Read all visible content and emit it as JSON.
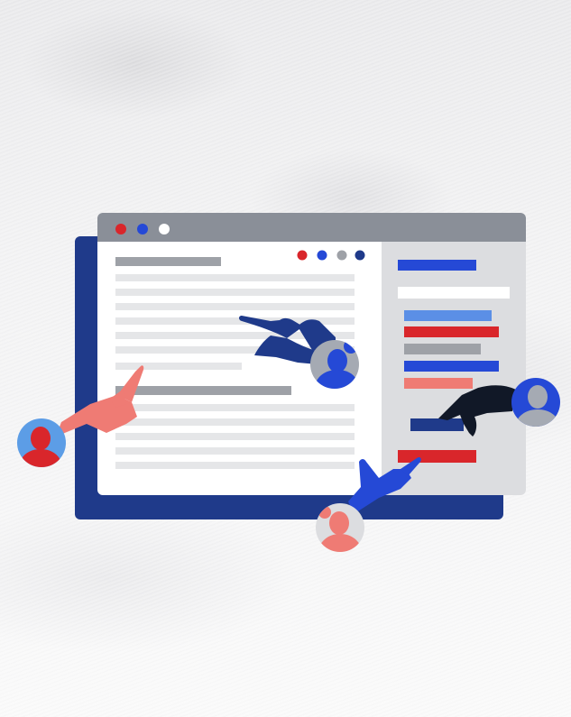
{
  "colors": {
    "navy": "#1f3a8a",
    "blue": "#2549d6",
    "light_blue": "#5b8fe6",
    "red": "#d9262b",
    "salmon": "#ef7b74",
    "gray": "#9ea1a7",
    "light_gray": "#e5e6e8",
    "window_bar": "#8a8f98",
    "sidebar": "#dcdde0",
    "avatar_bg_gray": "#a5aab3",
    "avatar_bg_lightblue": "#5c9de6",
    "dark_hand": "#111827"
  },
  "icons": {
    "window_controls": [
      "red-dot-icon",
      "blue-dot-icon",
      "white-dot-icon"
    ],
    "toolbar_dots": [
      "red-dot-icon",
      "blue-dot-icon",
      "gray-dot-icon",
      "navy-dot-icon"
    ],
    "people": [
      "avatar-red-person",
      "avatar-blue-person",
      "avatar-gray-person",
      "avatar-salmon-person"
    ]
  }
}
